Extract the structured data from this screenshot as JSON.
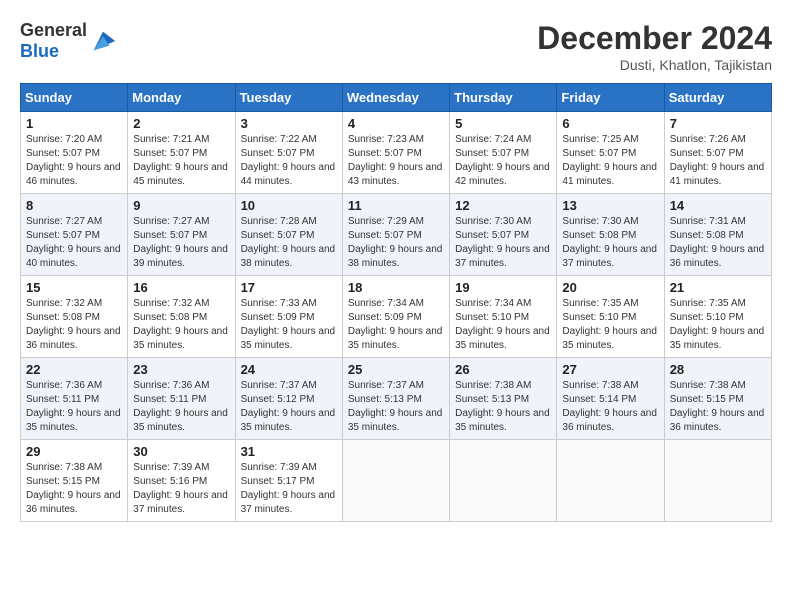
{
  "header": {
    "logo_general": "General",
    "logo_blue": "Blue",
    "title": "December 2024",
    "location": "Dusti, Khatlon, Tajikistan"
  },
  "columns": [
    "Sunday",
    "Monday",
    "Tuesday",
    "Wednesday",
    "Thursday",
    "Friday",
    "Saturday"
  ],
  "weeks": [
    [
      {
        "day": "1",
        "sunrise": "7:20 AM",
        "sunset": "5:07 PM",
        "daylight": "9 hours and 46 minutes."
      },
      {
        "day": "2",
        "sunrise": "7:21 AM",
        "sunset": "5:07 PM",
        "daylight": "9 hours and 45 minutes."
      },
      {
        "day": "3",
        "sunrise": "7:22 AM",
        "sunset": "5:07 PM",
        "daylight": "9 hours and 44 minutes."
      },
      {
        "day": "4",
        "sunrise": "7:23 AM",
        "sunset": "5:07 PM",
        "daylight": "9 hours and 43 minutes."
      },
      {
        "day": "5",
        "sunrise": "7:24 AM",
        "sunset": "5:07 PM",
        "daylight": "9 hours and 42 minutes."
      },
      {
        "day": "6",
        "sunrise": "7:25 AM",
        "sunset": "5:07 PM",
        "daylight": "9 hours and 41 minutes."
      },
      {
        "day": "7",
        "sunrise": "7:26 AM",
        "sunset": "5:07 PM",
        "daylight": "9 hours and 41 minutes."
      }
    ],
    [
      {
        "day": "8",
        "sunrise": "7:27 AM",
        "sunset": "5:07 PM",
        "daylight": "9 hours and 40 minutes."
      },
      {
        "day": "9",
        "sunrise": "7:27 AM",
        "sunset": "5:07 PM",
        "daylight": "9 hours and 39 minutes."
      },
      {
        "day": "10",
        "sunrise": "7:28 AM",
        "sunset": "5:07 PM",
        "daylight": "9 hours and 38 minutes."
      },
      {
        "day": "11",
        "sunrise": "7:29 AM",
        "sunset": "5:07 PM",
        "daylight": "9 hours and 38 minutes."
      },
      {
        "day": "12",
        "sunrise": "7:30 AM",
        "sunset": "5:07 PM",
        "daylight": "9 hours and 37 minutes."
      },
      {
        "day": "13",
        "sunrise": "7:30 AM",
        "sunset": "5:08 PM",
        "daylight": "9 hours and 37 minutes."
      },
      {
        "day": "14",
        "sunrise": "7:31 AM",
        "sunset": "5:08 PM",
        "daylight": "9 hours and 36 minutes."
      }
    ],
    [
      {
        "day": "15",
        "sunrise": "7:32 AM",
        "sunset": "5:08 PM",
        "daylight": "9 hours and 36 minutes."
      },
      {
        "day": "16",
        "sunrise": "7:32 AM",
        "sunset": "5:08 PM",
        "daylight": "9 hours and 35 minutes."
      },
      {
        "day": "17",
        "sunrise": "7:33 AM",
        "sunset": "5:09 PM",
        "daylight": "9 hours and 35 minutes."
      },
      {
        "day": "18",
        "sunrise": "7:34 AM",
        "sunset": "5:09 PM",
        "daylight": "9 hours and 35 minutes."
      },
      {
        "day": "19",
        "sunrise": "7:34 AM",
        "sunset": "5:10 PM",
        "daylight": "9 hours and 35 minutes."
      },
      {
        "day": "20",
        "sunrise": "7:35 AM",
        "sunset": "5:10 PM",
        "daylight": "9 hours and 35 minutes."
      },
      {
        "day": "21",
        "sunrise": "7:35 AM",
        "sunset": "5:10 PM",
        "daylight": "9 hours and 35 minutes."
      }
    ],
    [
      {
        "day": "22",
        "sunrise": "7:36 AM",
        "sunset": "5:11 PM",
        "daylight": "9 hours and 35 minutes."
      },
      {
        "day": "23",
        "sunrise": "7:36 AM",
        "sunset": "5:11 PM",
        "daylight": "9 hours and 35 minutes."
      },
      {
        "day": "24",
        "sunrise": "7:37 AM",
        "sunset": "5:12 PM",
        "daylight": "9 hours and 35 minutes."
      },
      {
        "day": "25",
        "sunrise": "7:37 AM",
        "sunset": "5:13 PM",
        "daylight": "9 hours and 35 minutes."
      },
      {
        "day": "26",
        "sunrise": "7:38 AM",
        "sunset": "5:13 PM",
        "daylight": "9 hours and 35 minutes."
      },
      {
        "day": "27",
        "sunrise": "7:38 AM",
        "sunset": "5:14 PM",
        "daylight": "9 hours and 36 minutes."
      },
      {
        "day": "28",
        "sunrise": "7:38 AM",
        "sunset": "5:15 PM",
        "daylight": "9 hours and 36 minutes."
      }
    ],
    [
      {
        "day": "29",
        "sunrise": "7:38 AM",
        "sunset": "5:15 PM",
        "daylight": "9 hours and 36 minutes."
      },
      {
        "day": "30",
        "sunrise": "7:39 AM",
        "sunset": "5:16 PM",
        "daylight": "9 hours and 37 minutes."
      },
      {
        "day": "31",
        "sunrise": "7:39 AM",
        "sunset": "5:17 PM",
        "daylight": "9 hours and 37 minutes."
      },
      null,
      null,
      null,
      null
    ]
  ],
  "labels": {
    "sunrise": "Sunrise:",
    "sunset": "Sunset:",
    "daylight": "Daylight:"
  }
}
